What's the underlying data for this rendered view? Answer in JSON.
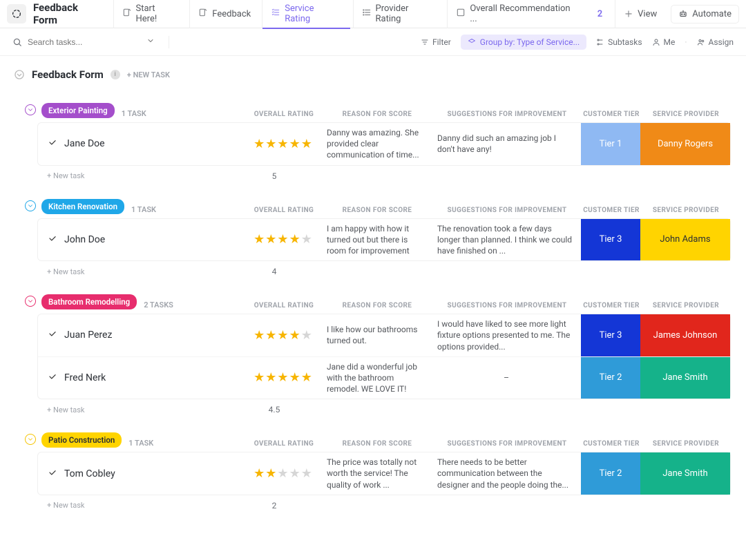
{
  "header": {
    "title": "Feedback Form",
    "tabs": [
      {
        "label": "Start Here!"
      },
      {
        "label": "Feedback"
      },
      {
        "label": "Service Rating",
        "active": true
      },
      {
        "label": "Provider Rating"
      },
      {
        "label": "Overall Recommendation ..."
      }
    ],
    "more_count": "2",
    "view_label": "View",
    "automate_label": "Automate"
  },
  "filterbar": {
    "search_placeholder": "Search tasks...",
    "filter": "Filter",
    "groupby": "Group by: Type of Service...",
    "subtasks": "Subtasks",
    "me": "Me",
    "assign": "Assign"
  },
  "list": {
    "title": "Feedback Form",
    "new_task_label": "+ NEW TASK"
  },
  "columns": {
    "rating": "OVERALL RATING",
    "reason": "REASON FOR SCORE",
    "suggestions": "SUGGESTIONS FOR IMPROVEMENT",
    "tier": "CUSTOMER TIER",
    "provider": "SERVICE PROVIDER"
  },
  "new_task_row": "+ New task",
  "groups": [
    {
      "name": "Exterior Painting",
      "pill_color": "#a44ecb",
      "toggle_color": "#a44ecb",
      "count": "1 TASK",
      "avg": "5",
      "tasks": [
        {
          "name": "Jane Doe",
          "stars": 5,
          "reason": "Danny was amazing. She provid­ed clear communication of time...",
          "suggestions": "Danny did such an amazing job I don't have any!",
          "tier": "Tier 1",
          "tier_color": "#8fb9f3",
          "provider": "Danny Rogers",
          "provider_color": "#f08a17"
        }
      ]
    },
    {
      "name": "Kitchen Renovation",
      "pill_color": "#1fa7e8",
      "toggle_color": "#1fa7e8",
      "count": "1 TASK",
      "avg": "4",
      "tasks": [
        {
          "name": "John Doe",
          "stars": 4,
          "reason": "I am happy with how it turned out but there is room for improvement",
          "suggestions": "The renovation took a few days longer than planned. I think we could have finished on ...",
          "tier": "Tier 3",
          "tier_color": "#1436d6",
          "provider": "John Adams",
          "provider_color": "#ffd400",
          "provider_text": "#2a2e34"
        }
      ]
    },
    {
      "name": "Bathroom Remodelling",
      "pill_color": "#e72d6d",
      "toggle_color": "#e72d6d",
      "count": "2 TASKS",
      "avg": "4.5",
      "tasks": [
        {
          "name": "Juan Perez",
          "stars": 4,
          "reason": "I like how our bathrooms turned out.",
          "suggestions": "I would have liked to see more light fixture op­tions presented to me. The options provided...",
          "tier": "Tier 3",
          "tier_color": "#1436d6",
          "provider": "James Johnson",
          "provider_color": "#e1261c"
        },
        {
          "name": "Fred Nerk",
          "stars": 5,
          "reason": "Jane did a wonderful job with the bathroom remodel. WE LOVE IT!",
          "suggestions": "–",
          "tier": "Tier 2",
          "tier_color": "#2f9bd8",
          "provider": "Jane Smith",
          "provider_color": "#15b28a"
        }
      ]
    },
    {
      "name": "Patio Construction",
      "pill_color": "#ffd400",
      "pill_text": "#2a2e34",
      "toggle_color": "#f5c400",
      "count": "1 TASK",
      "avg": "2",
      "tasks": [
        {
          "name": "Tom Cobley",
          "stars": 2,
          "reason": "The price was totally not worth the service! The quality of work ...",
          "suggestions": "There needs to be better communication be­tween the designer and the people doing the...",
          "tier": "Tier 2",
          "tier_color": "#2f9bd8",
          "provider": "Jane Smith",
          "provider_color": "#15b28a"
        }
      ]
    }
  ]
}
